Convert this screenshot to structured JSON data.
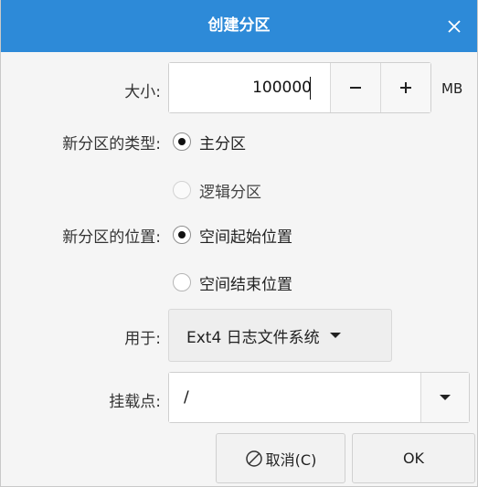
{
  "window": {
    "title": "创建分区",
    "title_bar_color": "#2d8ad8"
  },
  "icons": {
    "close": "close-icon",
    "minus": "minus-icon",
    "plus": "plus-icon",
    "dropdown_arrow": "caret-down-icon",
    "cancel": "cancel-circle-icon"
  },
  "size": {
    "label": "大小:",
    "value": "100000",
    "unit": "MB"
  },
  "partition_type": {
    "label": "新分区的类型:",
    "options": [
      {
        "label": "主分区",
        "selected": true
      },
      {
        "label": "逻辑分区",
        "selected": false,
        "enabled": false
      }
    ]
  },
  "partition_position": {
    "label": "新分区的位置:",
    "options": [
      {
        "label": "空间起始位置",
        "selected": true
      },
      {
        "label": "空间结束位置",
        "selected": false
      }
    ]
  },
  "use_for": {
    "label": "用于:",
    "value": "Ext4 日志文件系统"
  },
  "mount_point": {
    "label": "挂载点:",
    "value": "/"
  },
  "buttons": {
    "cancel": "取消(C)",
    "ok": "OK"
  }
}
